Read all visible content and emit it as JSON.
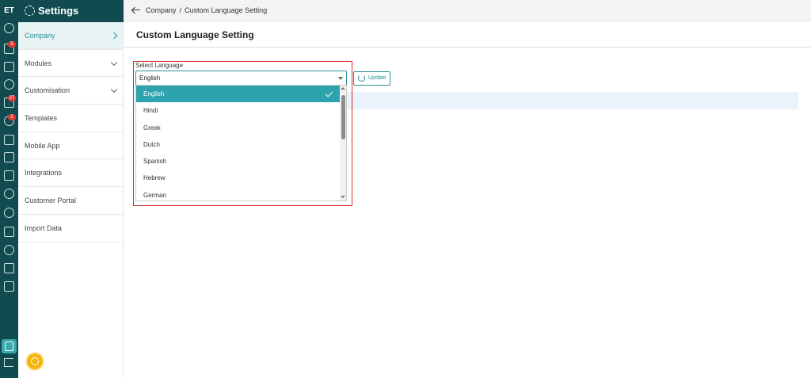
{
  "app": {
    "logo": "ET",
    "settings_title": "Settings"
  },
  "rail": {
    "icons": [
      "dashboard-icon",
      "rocket-icon",
      "calendar-icon",
      "user-search-icon",
      "inbox-icon",
      "user-alert-icon",
      "wallet-icon",
      "dollar-icon",
      "receipt-icon",
      "diamond-icon",
      "users-icon",
      "tools-icon",
      "handshake-icon",
      "calculator-icon",
      "bar-chart-icon"
    ],
    "badges": {
      "rocket": "5",
      "inbox": "27",
      "user_alert": "2"
    },
    "active_icon": "settings-list-icon",
    "logout_icon": "logout-icon"
  },
  "sidebar": {
    "items": [
      {
        "label": "Company",
        "arrow": "right",
        "active": true
      },
      {
        "label": "Modules",
        "arrow": "down"
      },
      {
        "label": "Customisation",
        "arrow": "down"
      },
      {
        "label": "Templates"
      },
      {
        "label": "Mobile App"
      },
      {
        "label": "Integrations"
      },
      {
        "label": "Customer Portal"
      },
      {
        "label": "Import Data"
      }
    ]
  },
  "breadcrumb": {
    "parent": "Company",
    "separator": "/",
    "current": "Custom Language Setting"
  },
  "page": {
    "title": "Custom Language Setting"
  },
  "language": {
    "label": "Select Language",
    "selected": "English",
    "options": [
      "English",
      "Hindi",
      "Greek",
      "Dutch",
      "Spanish",
      "Hebrew",
      "German"
    ],
    "update_label": "Update"
  },
  "colors": {
    "primary": "#114b4f",
    "accent": "#2da3ad",
    "highlight": "#d32f2f",
    "badge": "#e53935"
  }
}
